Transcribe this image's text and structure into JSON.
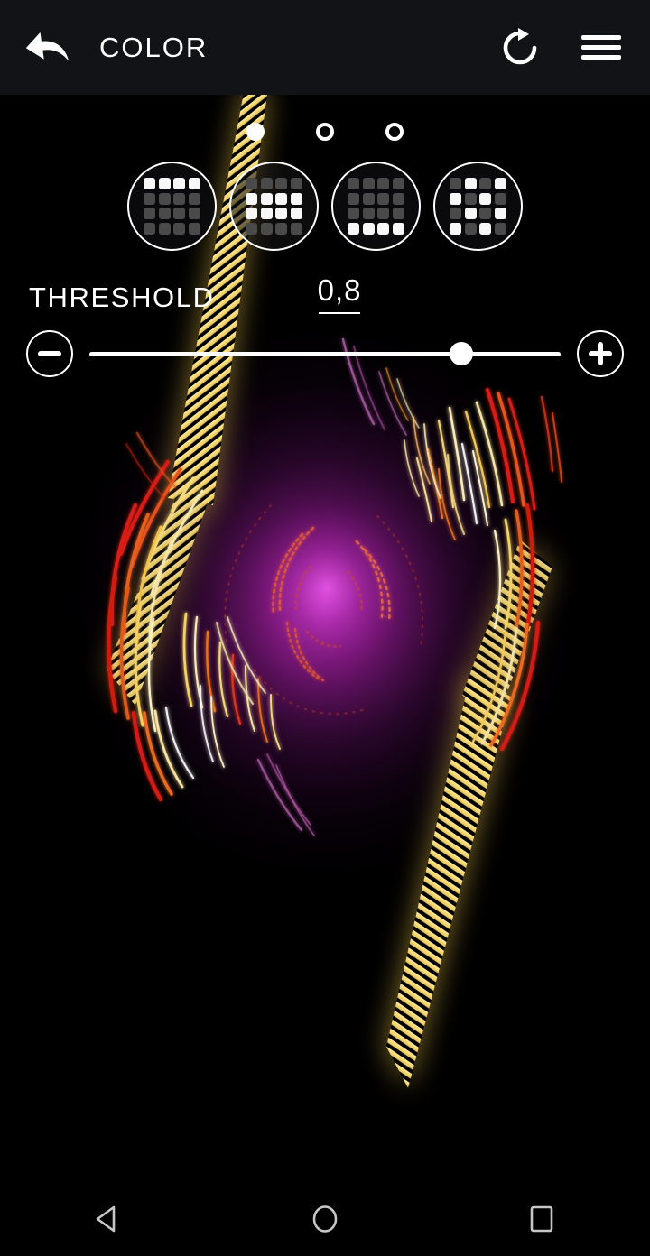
{
  "appbar": {
    "title": "COLOR",
    "back_icon": "undo-arrow-icon",
    "refresh_icon": "redo-refresh-icon",
    "menu_icon": "hamburger-menu-icon"
  },
  "pager": {
    "count": 3,
    "active_index": 0,
    "dots": [
      {
        "state": "active"
      },
      {
        "state": "inactive"
      },
      {
        "state": "inactive"
      }
    ]
  },
  "patterns": {
    "selected_index": 1,
    "items": [
      {
        "name": "pattern-top-row",
        "selected": false,
        "cells": [
          1,
          1,
          1,
          1,
          0,
          0,
          0,
          0,
          0,
          0,
          0,
          0,
          0,
          0,
          0,
          0
        ]
      },
      {
        "name": "pattern-middle-rows",
        "selected": true,
        "cells": [
          0,
          0,
          0,
          0,
          1,
          1,
          1,
          1,
          1,
          1,
          1,
          1,
          0,
          0,
          0,
          0
        ]
      },
      {
        "name": "pattern-bottom-row",
        "selected": false,
        "cells": [
          0,
          0,
          0,
          0,
          0,
          0,
          0,
          0,
          0,
          0,
          0,
          0,
          1,
          1,
          1,
          1
        ]
      },
      {
        "name": "pattern-checkerboard",
        "selected": false,
        "cells": [
          0,
          1,
          0,
          1,
          1,
          0,
          1,
          0,
          0,
          1,
          0,
          1,
          1,
          0,
          1,
          0
        ]
      }
    ]
  },
  "threshold": {
    "label": "THRESHOLD",
    "value": "0,8",
    "percent": 79,
    "decrease_label": "−",
    "increase_label": "+"
  },
  "navbar": {
    "back": "nav-back-triangle-icon",
    "home": "nav-home-circle-icon",
    "recents": "nav-recents-square-icon"
  },
  "colors": {
    "background": "#000000",
    "appbar": "#121316",
    "accent_white": "#ffffff",
    "glow_purple": "#a01ea0",
    "streak_yellow": "#f5e07a",
    "streak_orange": "#ef7b23",
    "streak_red": "#d81f14",
    "cell_off": "#4a4a4a",
    "cell_on": "#f7f7f7"
  }
}
